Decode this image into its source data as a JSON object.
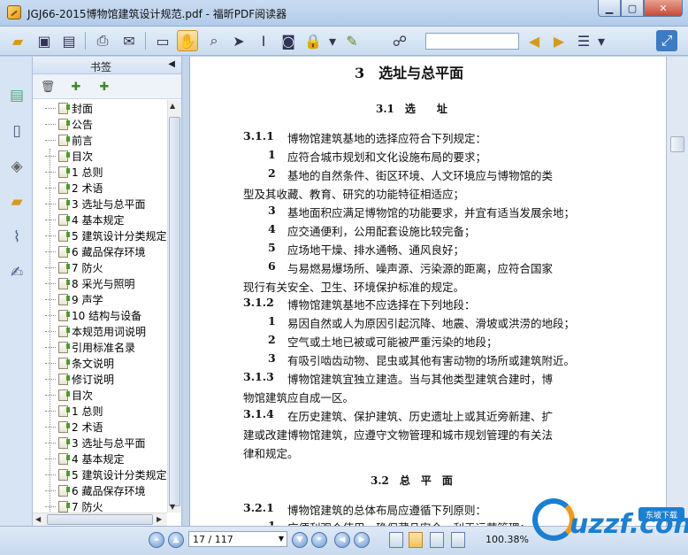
{
  "window": {
    "title": "JGJ66-2015博物馆建筑设计规范.pdf - 福昕PDF阅读器"
  },
  "toolbar": {
    "search_placeholder": ""
  },
  "panel": {
    "title": "书签",
    "bookmarks": [
      "封面",
      "公告",
      "前言",
      "目次",
      "1 总则",
      "2 术语",
      "3 选址与总平面",
      "4 基本规定",
      "5 建筑设计分类规定",
      "6 藏品保存环境",
      "7 防火",
      "8 采光与照明",
      "9 声学",
      "10 结构与设备",
      "本规范用词说明",
      "引用标准名录",
      "条文说明",
      "修订说明",
      "目次",
      "1 总则",
      "2 术语",
      "3 选址与总平面",
      "4 基本规定",
      "5 建筑设计分类规定",
      "6 藏品保存环境",
      "7 防火"
    ]
  },
  "document": {
    "chapter": "3　选址与总平面",
    "section1": "3.1　选　　址",
    "lines": [
      {
        "num": "3.1.1",
        "text": "博物馆建筑基地的选择应符合下列规定："
      },
      {
        "num": "1",
        "text": "应符合城市规划和文化设施布局的要求；"
      },
      {
        "num": "2",
        "text": "基地的自然条件、街区环境、人文环境应与博物馆的类"
      },
      {
        "num": "",
        "text": "型及其收藏、教育、研究的功能特征相适应；"
      },
      {
        "num": "3",
        "text": "基地面积应满足博物馆的功能要求，并宜有适当发展余地；"
      },
      {
        "num": "4",
        "text": "应交通便利，公用配套设施比较完备；"
      },
      {
        "num": "5",
        "text": "应场地干燥、排水通畅、通风良好；"
      },
      {
        "num": "6",
        "text": "与易燃易爆场所、噪声源、污染源的距离，应符合国家"
      },
      {
        "num": "",
        "text": "现行有关安全、卫生、环境保护标准的规定。"
      },
      {
        "num": "3.1.2",
        "text": "博物馆建筑基地不应选择在下列地段："
      },
      {
        "num": "1",
        "text": "易因自然或人为原因引起沉降、地震、滑坡或洪涝的地段；"
      },
      {
        "num": "2",
        "text": "空气或土地已被或可能被严重污染的地段；"
      },
      {
        "num": "3",
        "text": "有吸引啮齿动物、昆虫或其他有害动物的场所或建筑附近。"
      },
      {
        "num": "3.1.3",
        "text": "博物馆建筑宜独立建造。当与其他类型建筑合建时，博"
      },
      {
        "num": "",
        "text": "物馆建筑应自成一区。"
      },
      {
        "num": "3.1.4",
        "text": "在历史建筑、保护建筑、历史遗址上或其近旁新建、扩"
      },
      {
        "num": "",
        "text": "建或改建博物馆建筑，应遵守文物管理和城市规划管理的有关法"
      },
      {
        "num": "",
        "text": "律和规定。"
      }
    ],
    "section2": "3.2　总　平　面",
    "line_321_num": "3.2.1",
    "line_321_text": "博物馆建筑的总体布局应遵循下列原则：",
    "line_last_num": "1",
    "line_last_text": "应便利观众使用、确保藏品安全、利于运营管理；"
  },
  "status": {
    "page": "17 / 117",
    "zoom": "100.38%"
  },
  "watermark": {
    "brand": "uzzf.com",
    "tag": "东坡下载"
  }
}
